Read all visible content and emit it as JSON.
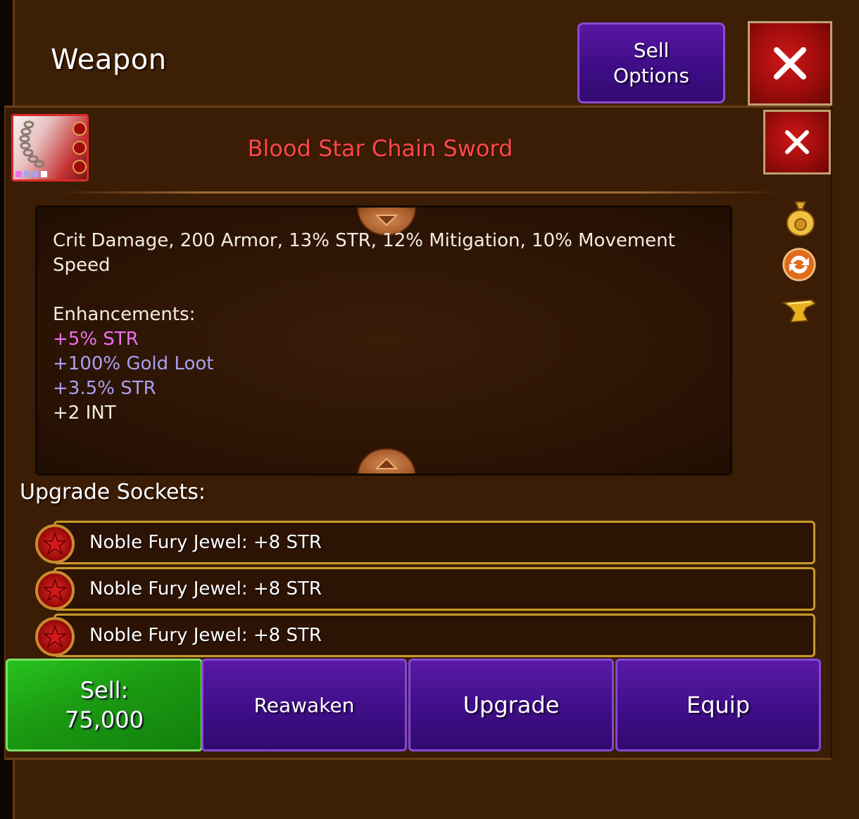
{
  "header": {
    "title": "Weapon",
    "sell_options_label": "Sell\nOptions",
    "close_label": "X"
  },
  "item": {
    "name": "Blood Star Chain Sword",
    "name_color": "#ff4848",
    "close_label": "X",
    "icon": "chain-sword-item-icon"
  },
  "description": {
    "stats_line1": "Crit Damage, 200 Armor, 13% STR, 12% Mitigation, 10% Movement",
    "stats_line2": "Speed",
    "enhancements_heading": "Enhancements:",
    "enhancements": [
      {
        "text": "+5% STR",
        "color": "#ee70ee"
      },
      {
        "text": "+100% Gold Loot",
        "color": "#a9a0f0"
      },
      {
        "text": "+3.5% STR",
        "color": "#a9a0f0"
      },
      {
        "text": "+2 INT",
        "color": "#f3ece2"
      }
    ]
  },
  "side_actions": [
    {
      "icon": "gold-bag-icon"
    },
    {
      "icon": "swap-icon"
    },
    {
      "icon": "anvil-icon"
    }
  ],
  "sockets": {
    "heading": "Upgrade Sockets:",
    "items": [
      {
        "label": "Noble Fury Jewel: +8 STR",
        "icon": "red-star-jewel-icon"
      },
      {
        "label": "Noble Fury Jewel: +8 STR",
        "icon": "red-star-jewel-icon"
      },
      {
        "label": "Noble Fury Jewel: +8 STR",
        "icon": "red-star-jewel-icon"
      }
    ]
  },
  "actions": {
    "sell_label": "Sell:\n75,000",
    "reawaken_label": "Reawaken",
    "upgrade_label": "Upgrade",
    "equip_label": "Equip"
  },
  "colors": {
    "background": "#3d1f05",
    "sell_green": "#1b9a12",
    "button_purple": "#3f0e88",
    "close_red": "#9e0c0c",
    "socket_border": "#c89a2a"
  }
}
